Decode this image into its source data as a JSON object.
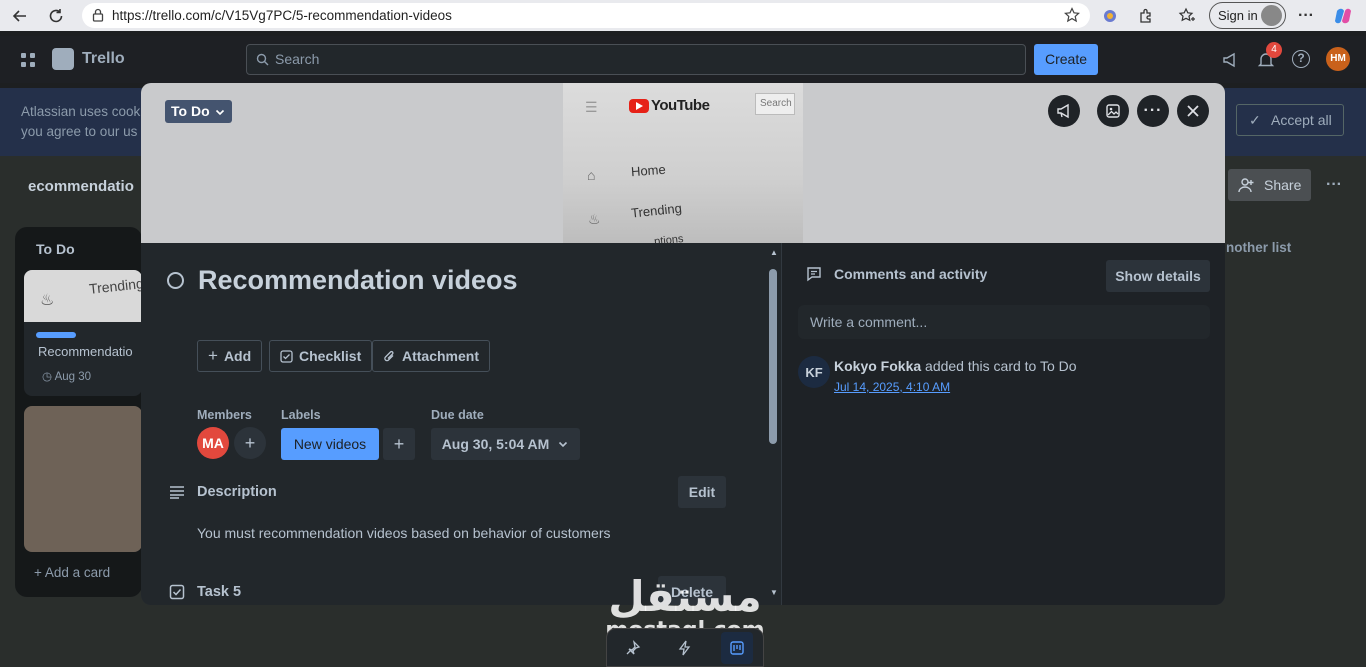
{
  "browser": {
    "url": "https://trello.com/c/V15Vg7PC/5-recommendation-videos",
    "sign_in_label": "Sign in"
  },
  "trello": {
    "brand": "Trello",
    "search_placeholder": "Search",
    "create_label": "Create",
    "notification_count": "4",
    "user_initials": "HM",
    "cookie_text_line1": "Atlassian uses cook",
    "cookie_text_line2": "you agree to our us",
    "accept_all_label": "Accept all",
    "board_title": "ecommendatio",
    "share_label": "Share",
    "list_title": "To Do",
    "card_preview_title": "Recommendatio",
    "card_preview_date": "Aug 30",
    "card_preview_cover_text": "Trending",
    "add_card_label": "Add a card",
    "another_list_label": "nother list"
  },
  "modal": {
    "list_badge": "To Do",
    "cover": {
      "brand_text": "YouTube",
      "search_text": "Search",
      "menu_home": "Home",
      "menu_trending": "Trending",
      "menu_partial": "...ptions"
    },
    "title": "Recommendation videos",
    "actions": {
      "add": "Add",
      "checklist": "Checklist",
      "attachment": "Attachment"
    },
    "members_label": "Members",
    "member_initials": "MA",
    "labels_label": "Labels",
    "label_name": "New videos",
    "due_label": "Due date",
    "due_value": "Aug 30, 5:04 AM",
    "description_heading": "Description",
    "edit_label": "Edit",
    "description_text": "You must recommendation videos based on behavior of customers",
    "checklist_heading": "Task 5",
    "delete_label": "Delete",
    "comments_heading": "Comments and activity",
    "show_details_label": "Show details",
    "comment_placeholder": "Write a comment...",
    "activity": {
      "initials": "KF",
      "user": "Kokyo Fokka",
      "text": " added this card to To Do",
      "time": "Jul 14, 2025, 4:10 AM"
    }
  },
  "watermark": {
    "arabic": "مستقل",
    "latin": "mostaql.com"
  },
  "colors": {
    "accent": "#579dff",
    "member_avatar": "#e2483d",
    "list_badge": "#44546f"
  }
}
